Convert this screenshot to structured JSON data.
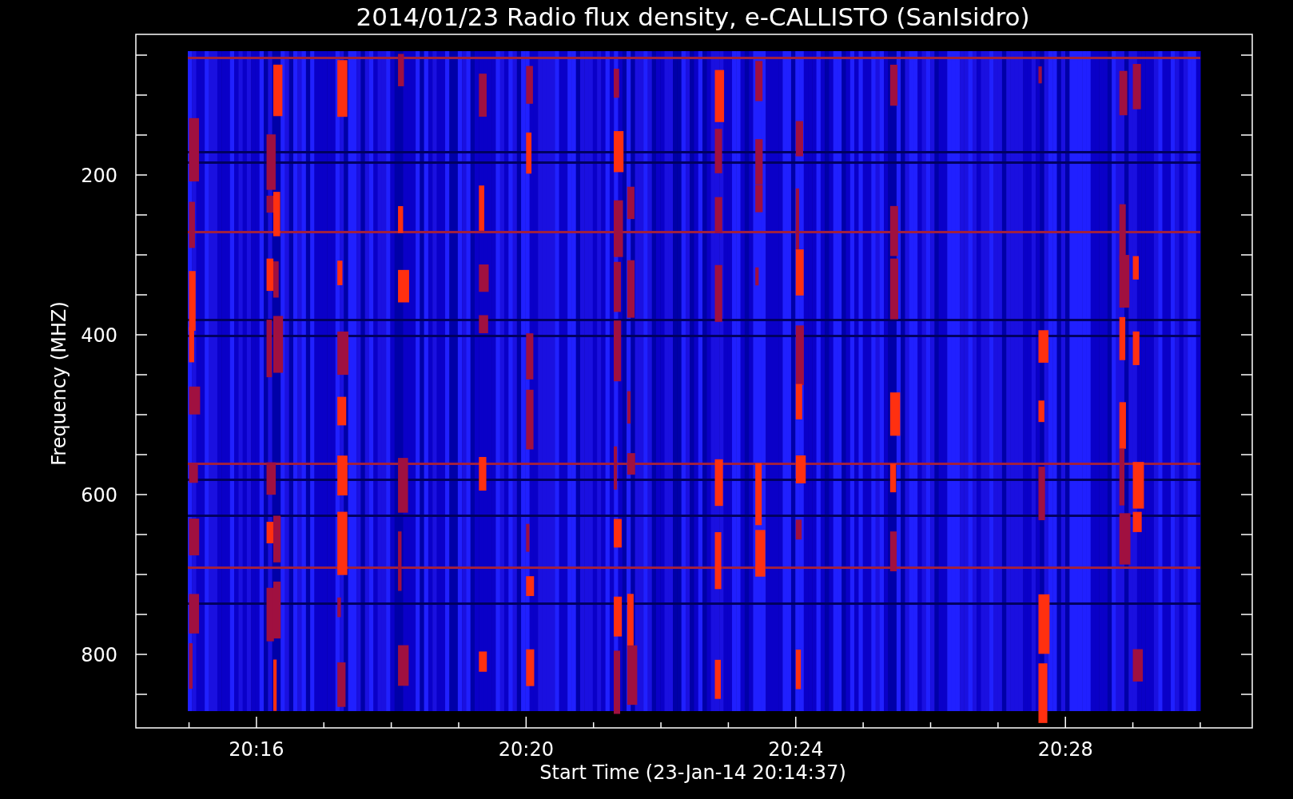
{
  "title": "2014/01/23  Radio flux density, e-CALLISTO (SanIsidro)",
  "y_axis": {
    "label": "Frequency (MHZ)",
    "ticks": [
      "200",
      "400",
      "600",
      "800"
    ]
  },
  "x_axis": {
    "label": "Start Time (23-Jan-14 20:14:37)",
    "ticks": [
      "20:16",
      "20:20",
      "20:24",
      "20:28"
    ]
  }
}
